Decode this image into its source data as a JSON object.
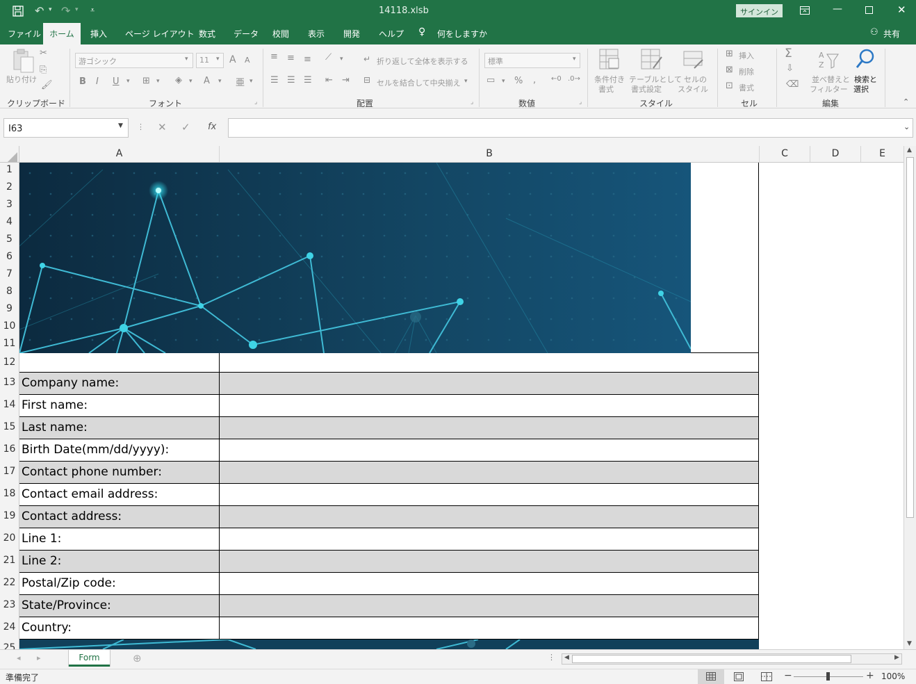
{
  "window": {
    "filename": "14118.xlsb",
    "signin_label": "サインイン",
    "share_label": "共有"
  },
  "menu": {
    "file": "ファイル",
    "home": "ホーム",
    "insert": "挿入",
    "page_layout": "ページ レイアウト",
    "formulas": "数式",
    "data": "データ",
    "review": "校閲",
    "view": "表示",
    "developer": "開発",
    "help": "ヘルプ",
    "tell_me": "何をしますか"
  },
  "ribbon": {
    "paste_label": "貼り付け",
    "clipboard_group": "クリップボード",
    "font_name": "游ゴシック",
    "font_size": "11",
    "font_group": "フォント",
    "bold": "B",
    "italic": "I",
    "underline": "U",
    "font_color": "A",
    "grow_font": "A",
    "shrink_font": "A",
    "wrap_text": "折り返して全体を表示する",
    "merge_center": "セルを結合して中央揃え",
    "alignment_group": "配置",
    "number_format": "標準",
    "percent": "%",
    "number_group": "数値",
    "conditional_format_1": "条件付き",
    "conditional_format_2": "書式",
    "format_table_1": "テーブルとして",
    "format_table_2": "書式設定",
    "cell_styles_1": "セルの",
    "cell_styles_2": "スタイル",
    "styles_group": "スタイル",
    "insert_cells": "挿入",
    "delete_cells": "削除",
    "format_cells": "書式",
    "cells_group": "セル",
    "sort_filter_1": "並べ替えと",
    "sort_filter_2": "フィルター",
    "find_select_1": "検索と",
    "find_select_2": "選択",
    "editing_group": "編集"
  },
  "formula_bar": {
    "name_box": "I63",
    "fx": "fx",
    "formula": ""
  },
  "columns": [
    "A",
    "B",
    "C",
    "D",
    "E"
  ],
  "rows": [
    "1",
    "2",
    "3",
    "4",
    "5",
    "6",
    "7",
    "8",
    "9",
    "10",
    "11",
    "12",
    "13",
    "14",
    "15",
    "16",
    "17",
    "18",
    "19",
    "20",
    "21",
    "22",
    "23",
    "24",
    "25"
  ],
  "form_fields": [
    "Company name:",
    "First name:",
    "Last name:",
    "Birth Date(mm/dd/yyyy):",
    "Contact phone number:",
    "Contact email address:",
    "Contact address:",
    "Line 1:",
    "Line 2:",
    "Postal/Zip code:",
    "State/Province:",
    "Country:"
  ],
  "sheet_tabs": [
    "Form"
  ],
  "status": {
    "ready": "準備完了",
    "zoom": "100%"
  },
  "colors": {
    "excel_green": "#217346",
    "banner_dark": "#0e2f45",
    "banner_light": "#15506f",
    "node_cyan": "#2fd6e8",
    "row_shade": "#d9d9d9"
  }
}
